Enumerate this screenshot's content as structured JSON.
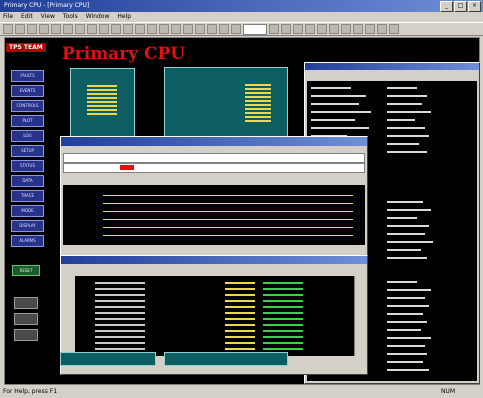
{
  "window": {
    "title": "Primary CPU - [Primary CPU]",
    "buttons": [
      "_",
      "□",
      "×"
    ]
  },
  "menu": [
    "File",
    "Edit",
    "View",
    "Tools",
    "Window",
    "Help"
  ],
  "logo_text": "TPS TEAM",
  "main_title": "Primary CPU",
  "nav": [
    "FAULTS",
    "EVENTS",
    "CONTROLS",
    "PLOT",
    "LOG",
    "SETUP",
    "STATUS",
    "DATA",
    "TRACE",
    "MODE",
    "DISPLAY",
    "ALARMS"
  ],
  "nav_green": "RESET",
  "status": {
    "left": "For Help, press F1",
    "right": "NUM"
  },
  "colors": {
    "background": "#000000",
    "title_red": "#e01010",
    "panel_teal": "#0c5e63",
    "nav_blue": "#27338a",
    "trace_yellow": "#e8e04a"
  }
}
